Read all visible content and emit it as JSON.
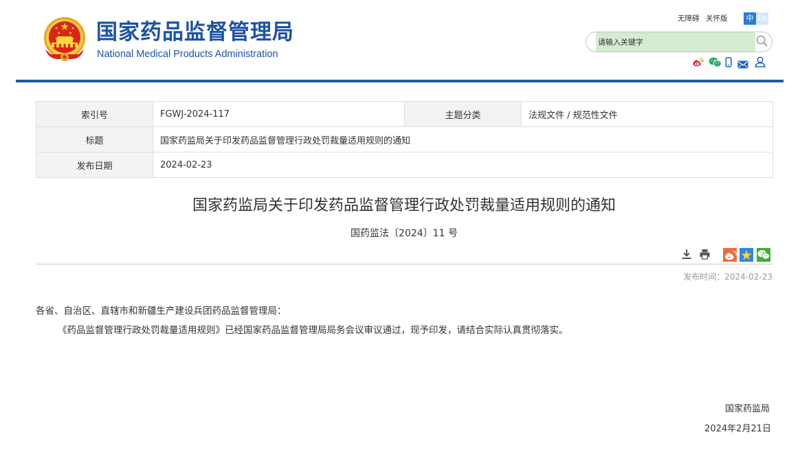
{
  "header": {
    "site_title_cn": "国家药品监督管理局",
    "site_title_en": "National Medical Products Administration",
    "accessibility_link": "无障碍",
    "care_mode_link": "关怀版",
    "lang_zh": "中",
    "lang_en": "En",
    "search_placeholder": "请输入关键字",
    "social_icons": [
      "weibo-icon",
      "wechat-icon",
      "mobile-icon",
      "mail-icon",
      "user-icon"
    ]
  },
  "meta_table": {
    "index_label": "索引号",
    "index_value": "FGWJ-2024-117",
    "category_label": "主题分类",
    "category_value": "法规文件 / 规范性文件",
    "title_label": "标题",
    "title_value": "国家药监局关于印发药品监督管理行政处罚裁量适用规则的通知",
    "date_label": "发布日期",
    "date_value": "2024-02-23"
  },
  "article": {
    "title": "国家药监局关于印发药品监督管理行政处罚裁量适用规则的通知",
    "doc_number": "国药监法〔2024〕11 号",
    "toolbar_icons": [
      "download-icon",
      "print-icon",
      "weibo-share-icon",
      "favorite-star-icon",
      "wechat-share-icon"
    ],
    "publish_time": "发布时间：2024-02-23",
    "salutation": "各省、自治区、直辖市和新疆生产建设兵团药品监督管理局：",
    "body": "《药品监督管理行政处罚裁量适用规则》已经国家药品监督管理局局务会议审议通过，现予印发，请结合实际认真贯彻落实。",
    "signature": "国家药监局",
    "sign_date": "2024年2月21日"
  },
  "colors": {
    "brand_blue": "#1c52a3",
    "header_rule": "#1d5aad",
    "lang_active_bg": "#2b7bd8",
    "lang_inactive_bg": "#d6e7f8",
    "search_fill": "#d5ebd2",
    "table_label_bg": "#f3f3f3",
    "table_border": "#dedede",
    "body_text": "#333333",
    "muted_text": "#999999"
  }
}
